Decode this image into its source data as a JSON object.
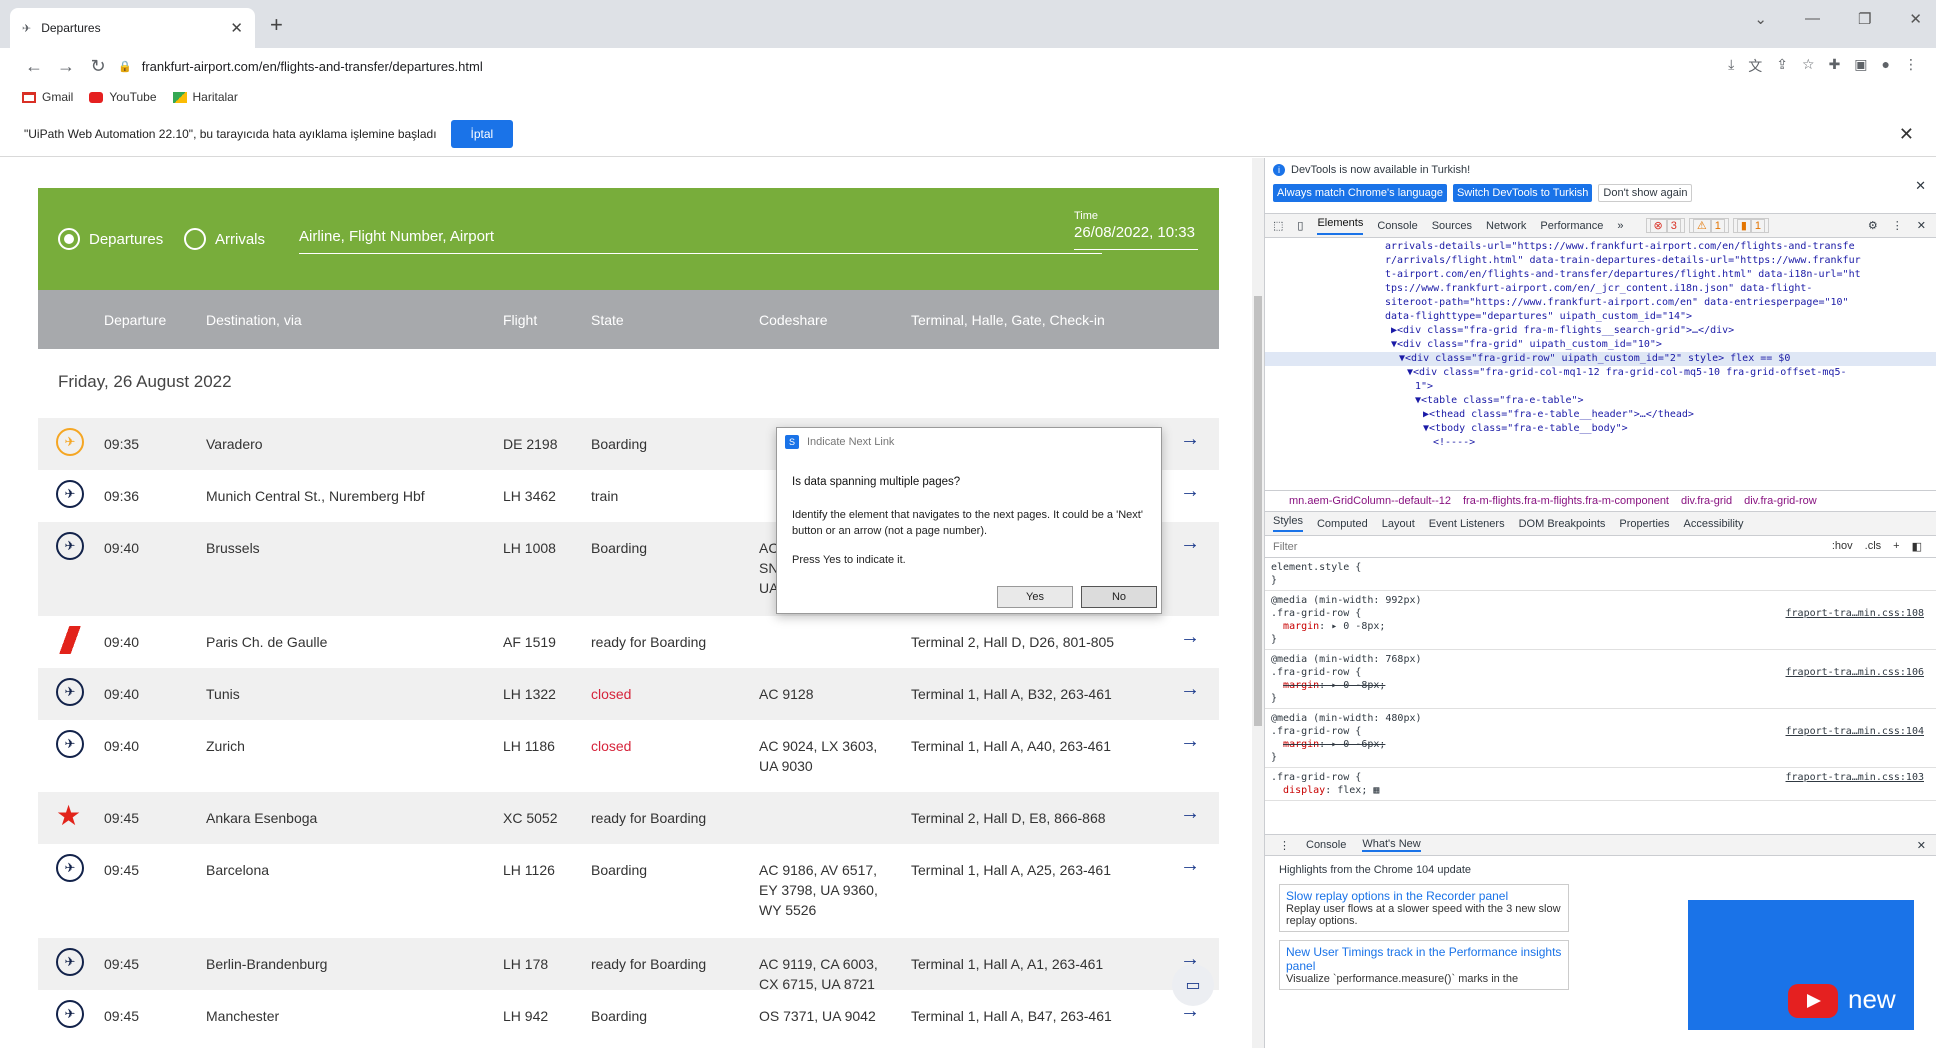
{
  "browser": {
    "tab_title": "Departures",
    "url": "frankfurt-airport.com/en/flights-and-transfer/departures.html",
    "bookmarks": [
      "Gmail",
      "YouTube",
      "Haritalar"
    ]
  },
  "infobar": {
    "message": "\"UiPath Web Automation 22.10\", bu tarayıcıda hata ayıklama işlemine başladı",
    "cancel_label": "İptal"
  },
  "search": {
    "radio_departures": "Departures",
    "radio_arrivals": "Arrivals",
    "input_placeholder": "Airline, Flight Number, Airport",
    "time_label": "Time",
    "time_value": "26/08/2022, 10:33"
  },
  "table_header": {
    "departure": "Departure",
    "destination": "Destination, via",
    "flight": "Flight",
    "state": "State",
    "codeshare": "Codeshare",
    "terminal": "Terminal, Halle, Gate, Check-in"
  },
  "day_header": "Friday, 26 August 2022",
  "flights": [
    {
      "time": "09:35",
      "dest": "Varadero",
      "flight": "DE 2198",
      "state": "Boarding",
      "codeshare": "",
      "terminal": ""
    },
    {
      "time": "09:36",
      "dest": "Munich Central St., Nuremberg Hbf",
      "flight": "LH 3462",
      "state": "train",
      "codeshare": "",
      "terminal": ""
    },
    {
      "time": "09:40",
      "dest": "Brussels",
      "flight": "LH 1008",
      "state": "Boarding",
      "codeshare": "AC\nSN\nUA",
      "terminal": ""
    },
    {
      "time": "09:40",
      "dest": "Paris Ch. de Gaulle",
      "flight": "AF 1519",
      "state": "ready for Boarding",
      "codeshare": "",
      "terminal": "Terminal 2, Hall D, D26, 801-805"
    },
    {
      "time": "09:40",
      "dest": "Tunis",
      "flight": "LH 1322",
      "state": "closed",
      "codeshare": "AC 9128",
      "terminal": "Terminal 1, Hall A, B32, 263-461"
    },
    {
      "time": "09:40",
      "dest": "Zurich",
      "flight": "LH 1186",
      "state": "closed",
      "codeshare": "AC 9024, LX 3603,\nUA 9030",
      "terminal": "Terminal 1, Hall A, A40, 263-461"
    },
    {
      "time": "09:45",
      "dest": "Ankara Esenboga",
      "flight": "XC 5052",
      "state": "ready for Boarding",
      "codeshare": "",
      "terminal": "Terminal 2, Hall D, E8, 866-868"
    },
    {
      "time": "09:45",
      "dest": "Barcelona",
      "flight": "LH 1126",
      "state": "Boarding",
      "codeshare": "AC 9186, AV 6517,\nEY 3798, UA 9360,\nWY 5526",
      "terminal": "Terminal 1, Hall A, A25, 263-461"
    },
    {
      "time": "09:45",
      "dest": "Berlin-Brandenburg",
      "flight": "LH 178",
      "state": "ready for Boarding",
      "codeshare": "AC 9119, CA 6003,\nCX 6715, UA 8721",
      "terminal": "Terminal 1, Hall A, A1, 263-461"
    },
    {
      "time": "09:45",
      "dest": "Manchester",
      "flight": "LH 942",
      "state": "Boarding",
      "codeshare": "OS 7371, UA 9042",
      "terminal": "Terminal 1, Hall A, B47, 263-461"
    }
  ],
  "dialog": {
    "title": "Indicate Next Link",
    "question": "Is data spanning multiple pages?",
    "desc": "Identify the element that navigates to the next pages. It could be a 'Next' button or an arrow (not a page number).",
    "instruction": "Press Yes to indicate it.",
    "yes_label": "Yes",
    "no_label": "No"
  },
  "devtools": {
    "info": "DevTools is now available in Turkish!",
    "btn_match": "Always match Chrome's language",
    "btn_switch": "Switch DevTools to Turkish",
    "btn_dont": "Don't show again",
    "tabs": [
      "Elements",
      "Console",
      "Sources",
      "Network",
      "Performance"
    ],
    "badges": [
      "3",
      "1",
      "1"
    ],
    "elements_lines": [
      "arrivals-details-url=\"https://www.frankfurt-airport.com/en/flights-and-transfe",
      "r/arrivals/flight.html\" data-train-departures-details-url=\"https://www.frankfur",
      "t-airport.com/en/flights-and-transfer/departures/flight.html\" data-i18n-url=\"ht",
      "tps://www.frankfurt-airport.com/en/_jcr_content.i18n.json\" data-flight-",
      "siteroot-path=\"https://www.frankfurt-airport.com/en\" data-entriesperpage=\"10\"",
      "data-flighttype=\"departures\" uipath_custom_id=\"14\">",
      "▶<div class=\"fra-grid fra-m-flights__search-grid\">…</div>",
      "▼<div class=\"fra-grid\" uipath_custom_id=\"10\">",
      "▼<div class=\"fra-grid-row\" uipath_custom_id=\"2\" style> flex == $0",
      "▼<div class=\"fra-grid-col-mq1-12 fra-grid-col-mq5-10 fra-grid-offset-mq5-",
      "1\">",
      "▼<table class=\"fra-e-table\">",
      "▶<thead class=\"fra-e-table__header\">…</thead>",
      "▼<tbody class=\"fra-e-table__body\">",
      "<!---->"
    ],
    "crumbs": [
      "mn.aem-GridColumn--default--12",
      "fra-m-flights.fra-m-flights.fra-m-component",
      "div.fra-grid",
      "div.fra-grid-row"
    ],
    "sub_tabs": [
      "Styles",
      "Computed",
      "Layout",
      "Event Listeners",
      "DOM Breakpoints",
      "Properties",
      "Accessibility"
    ],
    "filter_placeholder": "Filter",
    "filter_hov": ":hov",
    "filter_cls": ".cls",
    "drawer_tabs": [
      "Console",
      "What's New"
    ],
    "whatsnew_title": "Highlights from the Chrome 104 update",
    "card1_title": "Slow replay options in the Recorder panel",
    "card1_text": "Replay user flows at a slower speed with the 3 new slow replay options.",
    "card2_title": "New User Timings track in the Performance insights panel",
    "card2_text": "Visualize `performance.measure()` marks in the",
    "img_text": "new"
  }
}
